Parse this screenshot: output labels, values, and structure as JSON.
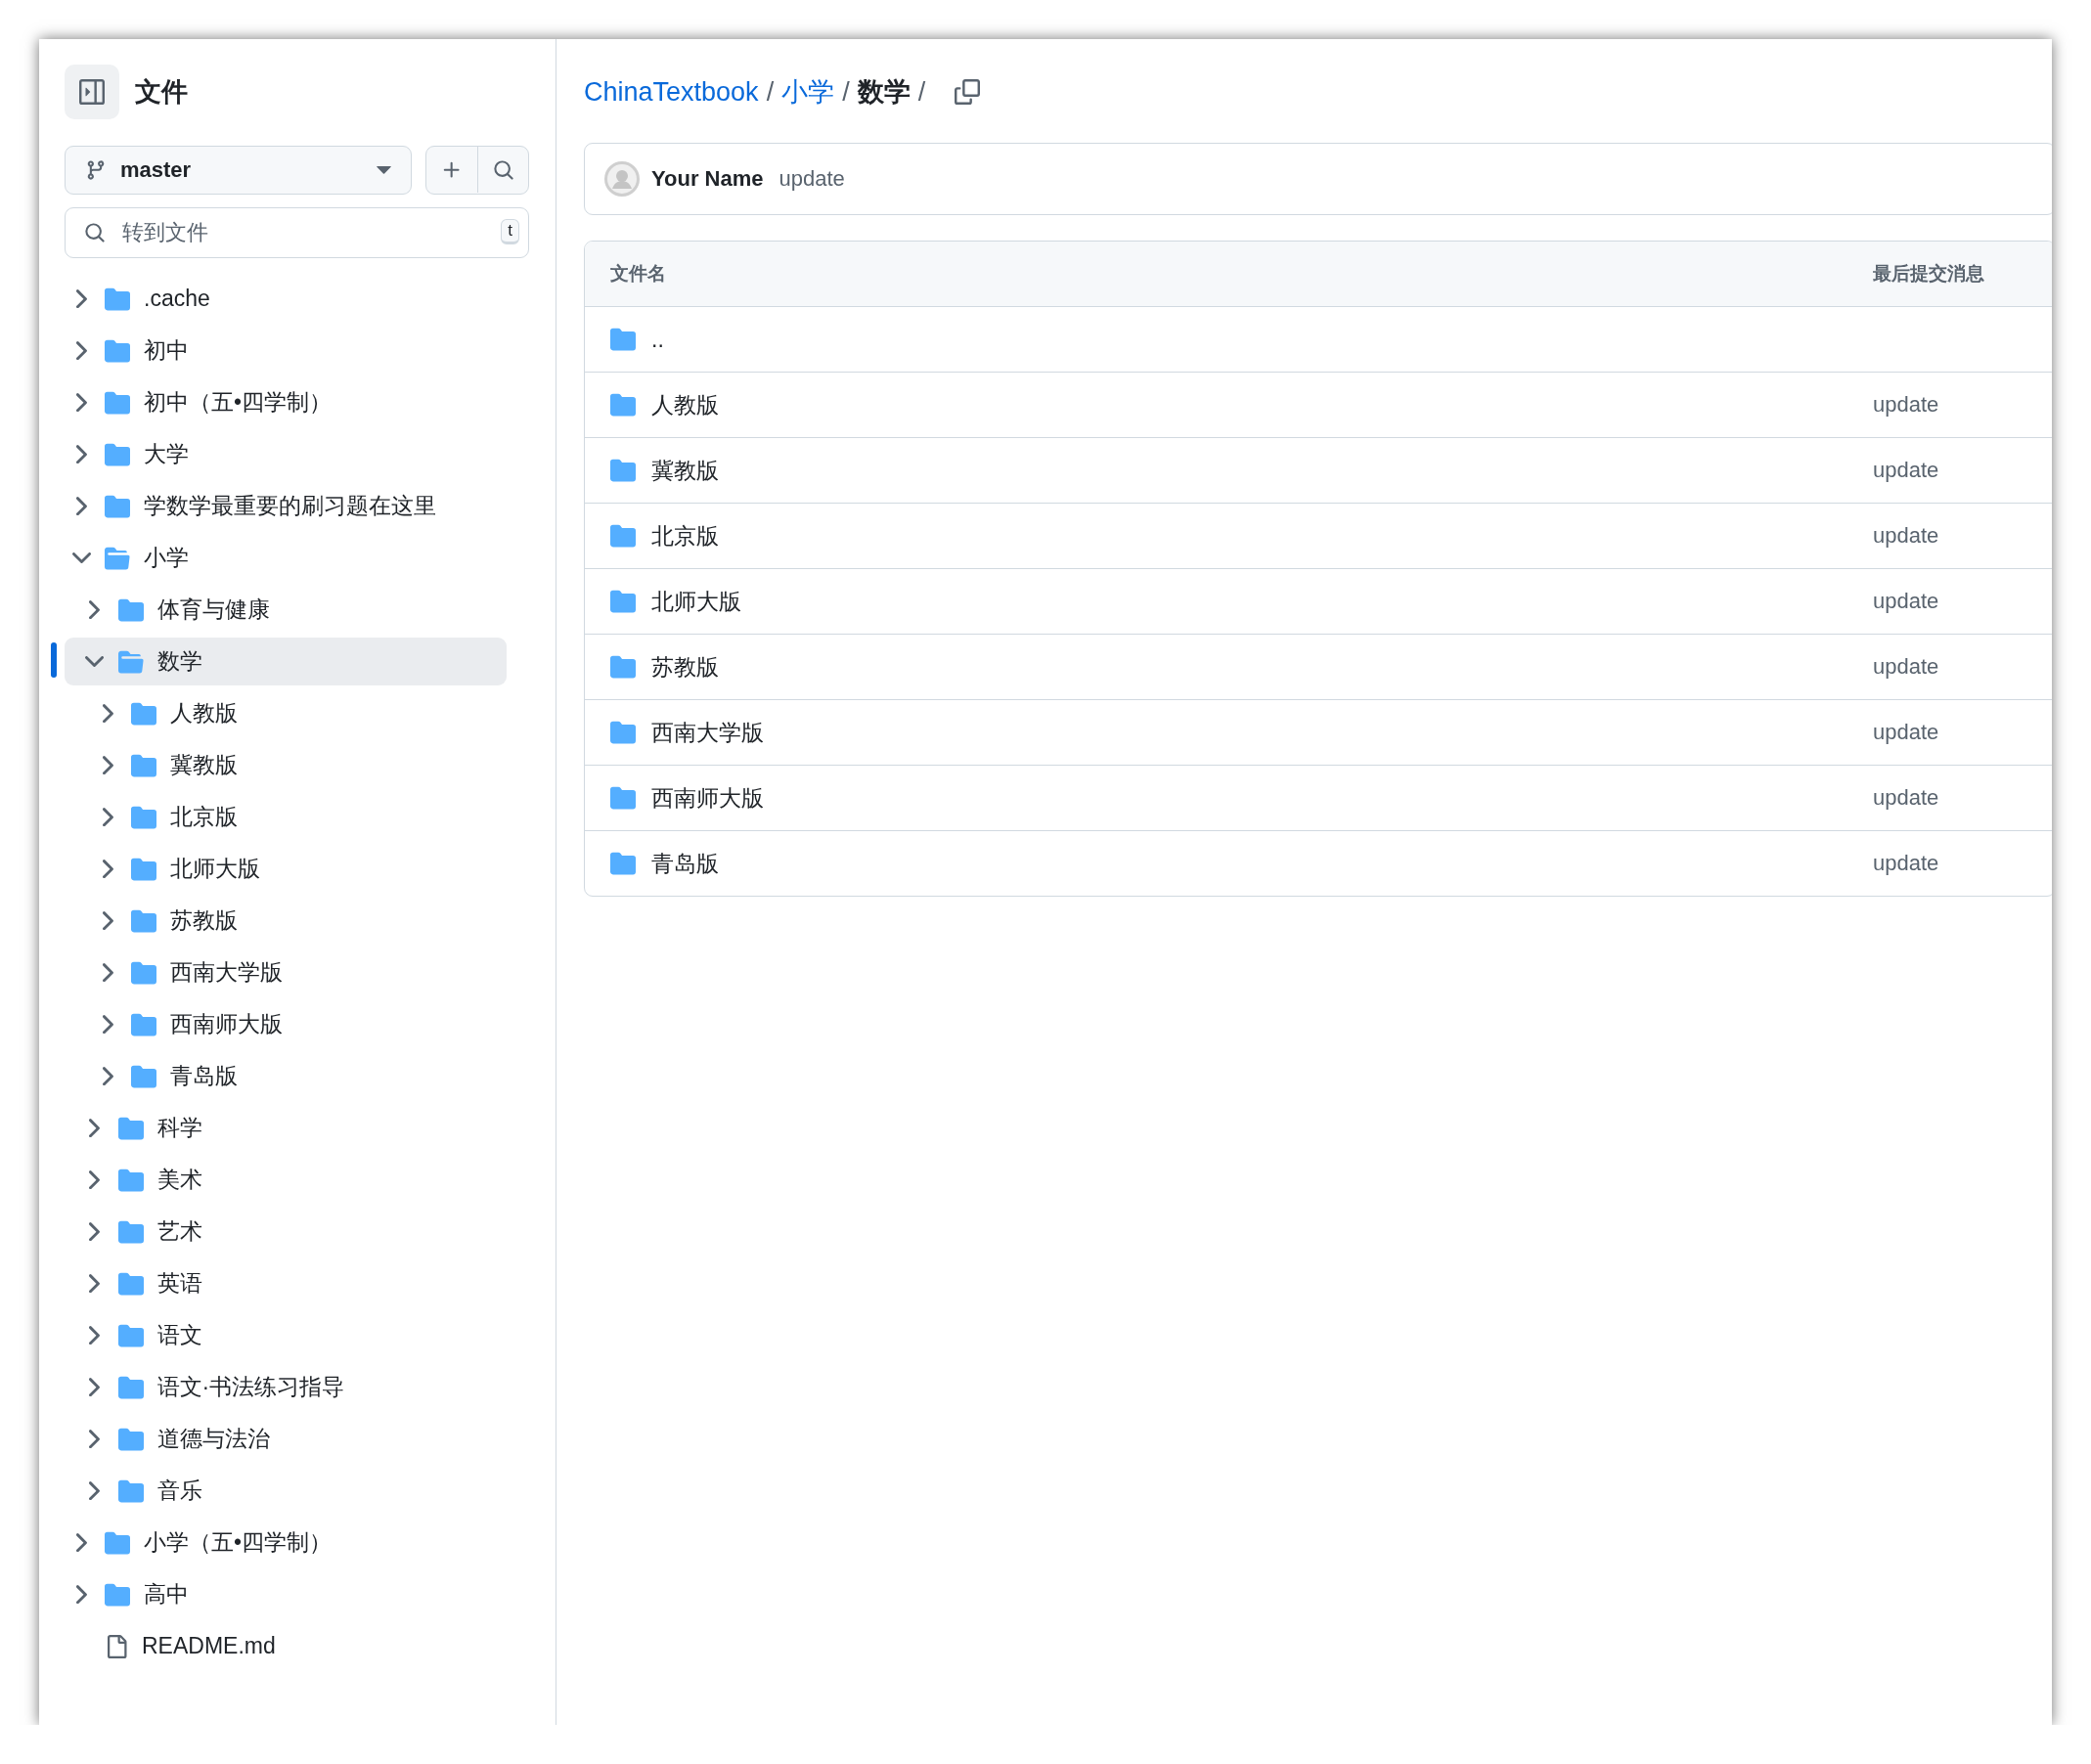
{
  "sidebar": {
    "title": "文件",
    "branch": "master",
    "search": {
      "placeholder": "转到文件",
      "shortcut": "t"
    },
    "tree": [
      {
        "name": ".cache",
        "kind": "folder",
        "expanded": false,
        "selected": false
      },
      {
        "name": "初中",
        "kind": "folder",
        "expanded": false,
        "selected": false
      },
      {
        "name": "初中（五•四学制）",
        "kind": "folder",
        "expanded": false,
        "selected": false
      },
      {
        "name": "大学",
        "kind": "folder",
        "expanded": false,
        "selected": false
      },
      {
        "name": "学数学最重要的刷习题在这里",
        "kind": "folder",
        "expanded": false,
        "selected": false
      },
      {
        "name": "小学",
        "kind": "folder",
        "expanded": true,
        "selected": false,
        "children": [
          {
            "name": "体育与健康",
            "kind": "folder",
            "expanded": false,
            "selected": false
          },
          {
            "name": "数学",
            "kind": "folder",
            "expanded": true,
            "selected": true,
            "children": [
              {
                "name": "人教版",
                "kind": "folder",
                "expanded": false,
                "selected": false
              },
              {
                "name": "冀教版",
                "kind": "folder",
                "expanded": false,
                "selected": false
              },
              {
                "name": "北京版",
                "kind": "folder",
                "expanded": false,
                "selected": false
              },
              {
                "name": "北师大版",
                "kind": "folder",
                "expanded": false,
                "selected": false
              },
              {
                "name": "苏教版",
                "kind": "folder",
                "expanded": false,
                "selected": false
              },
              {
                "name": "西南大学版",
                "kind": "folder",
                "expanded": false,
                "selected": false
              },
              {
                "name": "西南师大版",
                "kind": "folder",
                "expanded": false,
                "selected": false
              },
              {
                "name": "青岛版",
                "kind": "folder",
                "expanded": false,
                "selected": false
              }
            ]
          },
          {
            "name": "科学",
            "kind": "folder",
            "expanded": false,
            "selected": false
          },
          {
            "name": "美术",
            "kind": "folder",
            "expanded": false,
            "selected": false
          },
          {
            "name": "艺术",
            "kind": "folder",
            "expanded": false,
            "selected": false
          },
          {
            "name": "英语",
            "kind": "folder",
            "expanded": false,
            "selected": false
          },
          {
            "name": "语文",
            "kind": "folder",
            "expanded": false,
            "selected": false
          },
          {
            "name": "语文·书法练习指导",
            "kind": "folder",
            "expanded": false,
            "selected": false
          },
          {
            "name": "道德与法治",
            "kind": "folder",
            "expanded": false,
            "selected": false
          },
          {
            "name": "音乐",
            "kind": "folder",
            "expanded": false,
            "selected": false
          }
        ]
      },
      {
        "name": "小学（五•四学制）",
        "kind": "folder",
        "expanded": false,
        "selected": false
      },
      {
        "name": "高中",
        "kind": "folder",
        "expanded": false,
        "selected": false
      },
      {
        "name": "README.md",
        "kind": "file",
        "selected": false
      }
    ]
  },
  "breadcrumb": {
    "separator": "/",
    "items": [
      {
        "text": "ChinaTextbook",
        "current": false
      },
      {
        "text": "小学",
        "current": false
      },
      {
        "text": "数学",
        "current": true
      }
    ]
  },
  "commit": {
    "author": "Your Name",
    "message": "update"
  },
  "table": {
    "columns": [
      "文件名",
      "最后提交消息"
    ],
    "rows": [
      {
        "name": ".."
      },
      {
        "name": "人教版",
        "message": "update"
      },
      {
        "name": "冀教版",
        "message": "update"
      },
      {
        "name": "北京版",
        "message": "update"
      },
      {
        "name": "北师大版",
        "message": "update"
      },
      {
        "name": "苏教版",
        "message": "update"
      },
      {
        "name": "西南大学版",
        "message": "update"
      },
      {
        "name": "西南师大版",
        "message": "update"
      },
      {
        "name": "青岛版",
        "message": "update"
      }
    ]
  }
}
